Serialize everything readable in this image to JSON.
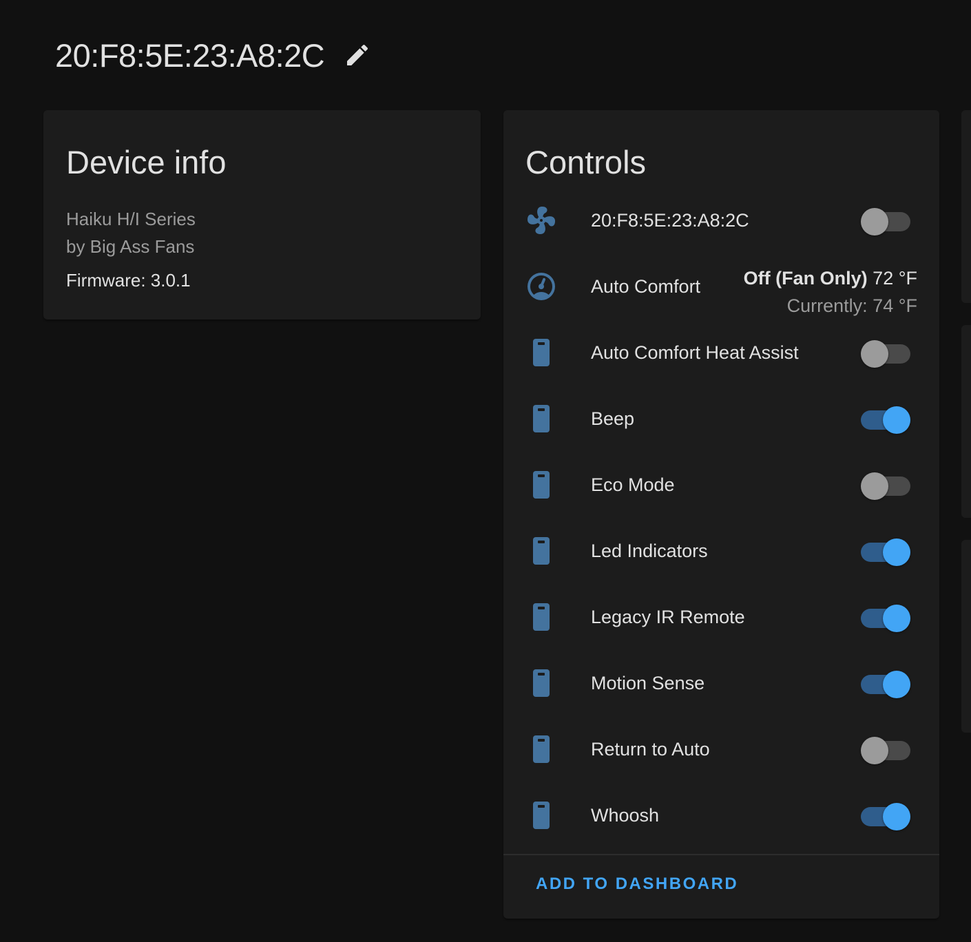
{
  "header": {
    "device_name": "20:F8:5E:23:A8:2C",
    "edit_icon": "pencil-icon"
  },
  "device_info": {
    "title": "Device info",
    "model": "Haiku H/I Series",
    "manufacturer": "by Big Ass Fans",
    "firmware": "Firmware: 3.0.1"
  },
  "controls": {
    "title": "Controls",
    "fan": {
      "label": "20:F8:5E:23:A8:2C",
      "icon": "fan-icon",
      "on": false
    },
    "climate": {
      "label": "Auto Comfort",
      "icon": "thermostat-icon",
      "mode": "Off (Fan Only)",
      "target": "72 °F",
      "current": "Currently: 74 °F"
    },
    "switches": [
      {
        "label": "Auto Comfort Heat Assist",
        "on": false
      },
      {
        "label": "Beep",
        "on": true
      },
      {
        "label": "Eco Mode",
        "on": false
      },
      {
        "label": "Led Indicators",
        "on": true
      },
      {
        "label": "Legacy IR Remote",
        "on": true
      },
      {
        "label": "Motion Sense",
        "on": true
      },
      {
        "label": "Return to Auto",
        "on": false
      },
      {
        "label": "Whoosh",
        "on": true
      }
    ],
    "switch_icon": "light-switch-icon",
    "add_button": "ADD TO DASHBOARD"
  },
  "colors": {
    "accent": "#42a5f5",
    "icon": "#44739e",
    "background": "#111111",
    "card": "#1c1c1c"
  }
}
